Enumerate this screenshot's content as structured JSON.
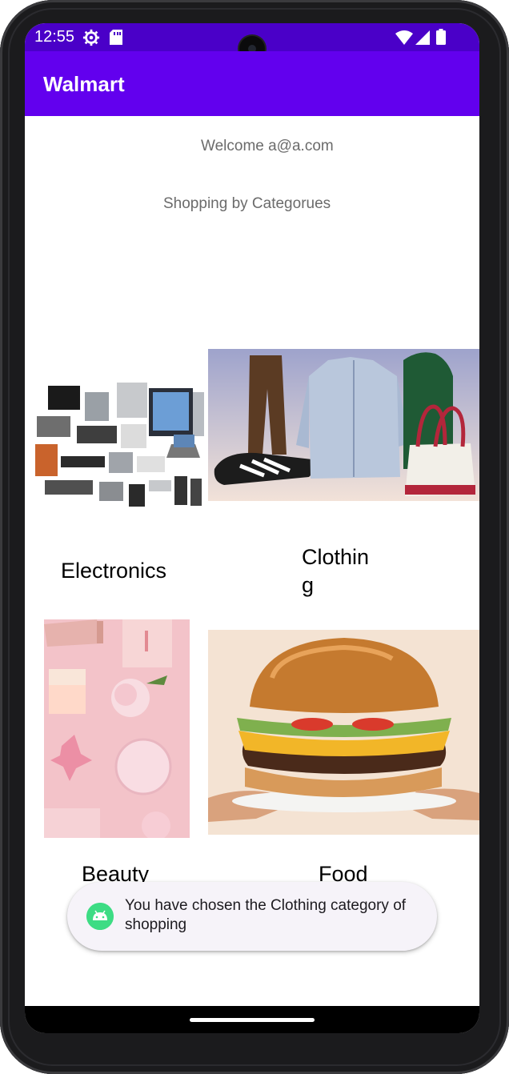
{
  "status_bar": {
    "time": "12:55",
    "icons": [
      "settings-gear-icon",
      "sd-card-icon",
      "wifi-icon",
      "signal-icon",
      "battery-icon"
    ]
  },
  "app_bar": {
    "title": "Walmart",
    "color": "#6200ee"
  },
  "main": {
    "welcome_text": "Welcome a@a.com",
    "subtitle": "Shopping by Categorues",
    "categories": [
      {
        "label": "Electronics",
        "image": "electronics-image"
      },
      {
        "label": "Clothing",
        "image": "clothing-image"
      },
      {
        "label": "Beauty",
        "image": "beauty-image"
      },
      {
        "label": "Food",
        "image": "food-image"
      }
    ]
  },
  "toast": {
    "message": "You have chosen the Clothing category of shopping",
    "icon": "android-icon"
  }
}
